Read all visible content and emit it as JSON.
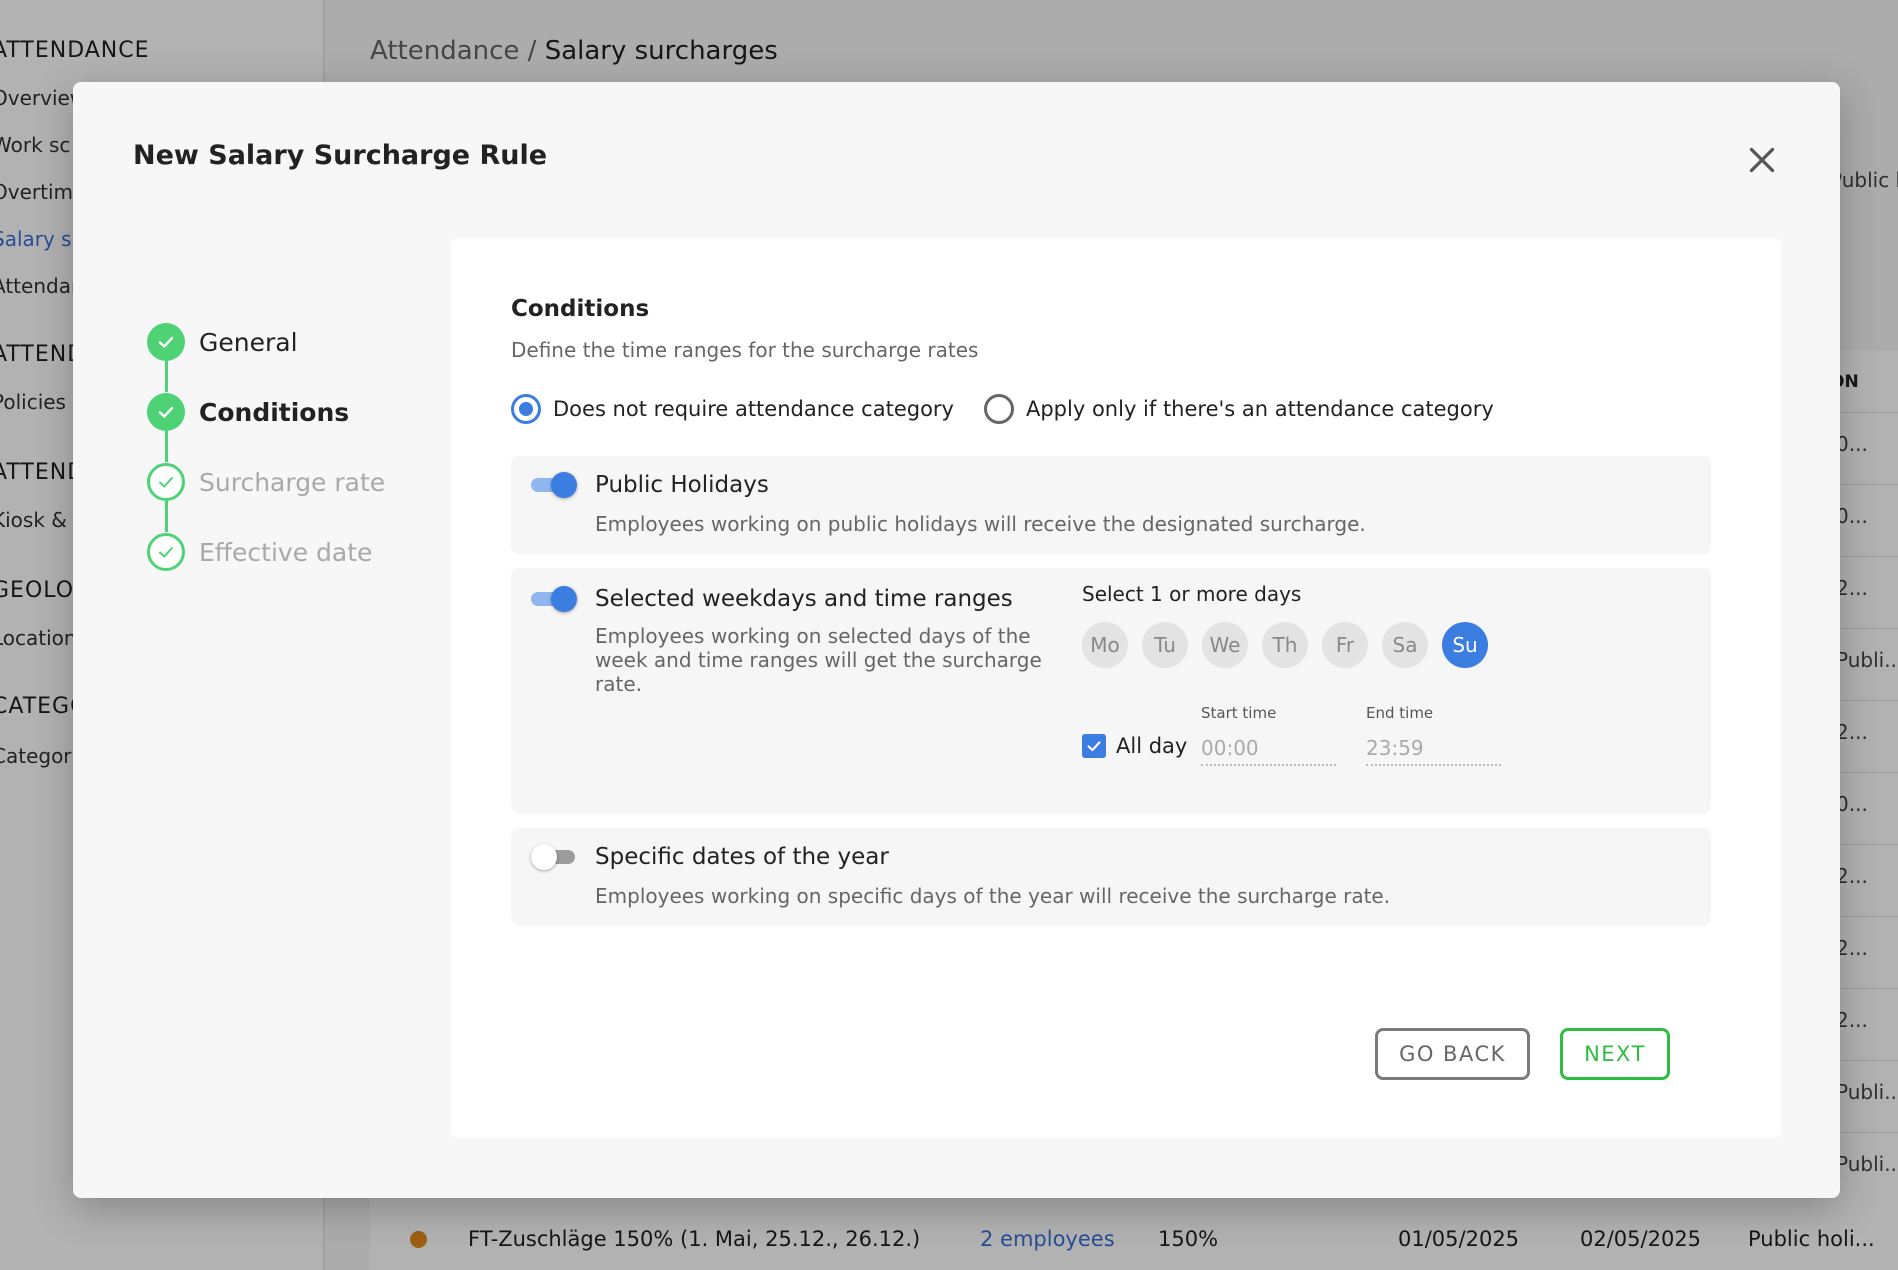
{
  "background": {
    "sidebar": {
      "groups": [
        "ATTENDANCE",
        "ATTEND",
        "ATTEND",
        "GEOLO",
        "CATEGO"
      ],
      "items": [
        "Overview",
        "Work sc",
        "Overtime",
        "Salary su",
        "Attendan",
        "Policies",
        "Kiosk & s",
        "Location",
        "Categori"
      ]
    },
    "breadcrumb": {
      "parent": "Attendance",
      "separator": "/",
      "current": "Salary surcharges"
    },
    "header_partial": "Public ho",
    "column_partial": "ON",
    "row_edges": [
      "0...",
      "0...",
      "2...",
      "Publi...",
      "2...",
      "0...",
      "2...",
      "2...",
      "2...",
      "Publi...",
      "Publi..."
    ],
    "last_row": {
      "name": "FT-Zuschläge 150% (1. Mai, 25.12., 26.12.)",
      "employees": "2 employees",
      "rate": "150%",
      "start": "01/05/2025",
      "end": "02/05/2025",
      "type": "Public holi..."
    }
  },
  "modal": {
    "title": "New Salary Surcharge Rule",
    "close_icon": "close-icon",
    "steps": [
      {
        "label": "General",
        "state": "done"
      },
      {
        "label": "Conditions",
        "state": "current"
      },
      {
        "label": "Surcharge rate",
        "state": "pending"
      },
      {
        "label": "Effective date",
        "state": "pending"
      }
    ],
    "section": {
      "title": "Conditions",
      "subtitle": "Define the time ranges for the surcharge rates"
    },
    "radios": [
      {
        "label": "Does not require attendance category",
        "checked": true
      },
      {
        "label": "Apply only if there's an attendance category",
        "checked": false
      }
    ],
    "cards": {
      "public_holidays": {
        "enabled": true,
        "title": "Public Holidays",
        "description": "Employees working on public holidays will receive the designated surcharge."
      },
      "weekdays": {
        "enabled": true,
        "title": "Selected weekdays and time ranges",
        "description": "Employees working on selected days of the week and time ranges will get the surcharge rate.",
        "days_label": "Select 1 or more days",
        "days": [
          {
            "label": "Mo",
            "selected": false
          },
          {
            "label": "Tu",
            "selected": false
          },
          {
            "label": "We",
            "selected": false
          },
          {
            "label": "Th",
            "selected": false
          },
          {
            "label": "Fr",
            "selected": false
          },
          {
            "label": "Sa",
            "selected": false
          },
          {
            "label": "Su",
            "selected": true
          }
        ],
        "all_day": {
          "label": "All day",
          "checked": true
        },
        "start_time": {
          "label": "Start time",
          "value": "00:00"
        },
        "end_time": {
          "label": "End time",
          "value": "23:59"
        }
      },
      "specific_dates": {
        "enabled": false,
        "title": "Specific dates of the year",
        "description": "Employees working on specific days of the year will receive the surcharge rate."
      }
    },
    "buttons": {
      "back": "GO BACK",
      "next": "NEXT"
    },
    "colors": {
      "accent": "#3b7de0",
      "success": "#4fd276",
      "next": "#2fbd3f"
    }
  }
}
